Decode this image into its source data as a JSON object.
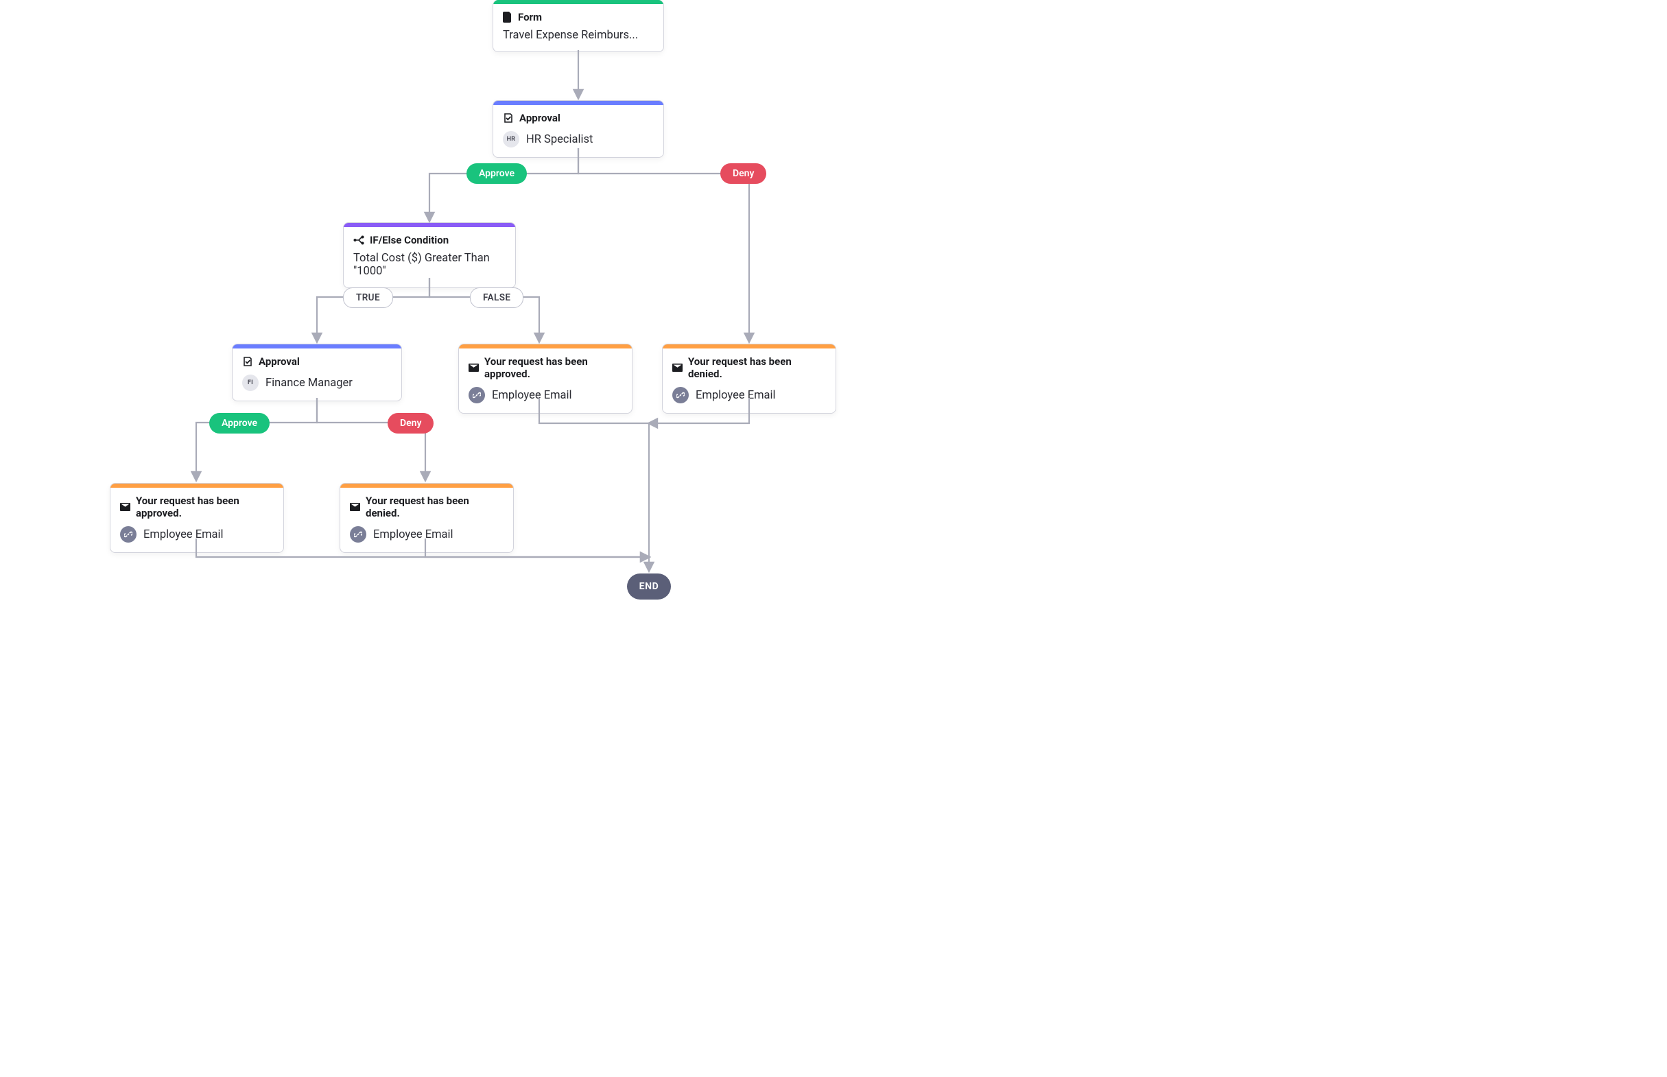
{
  "colors": {
    "green": "#19c37d",
    "blue": "#6a7dff",
    "purple": "#8a5cf6",
    "orange": "#ff9f43",
    "red": "#e64c5e",
    "arrow": "#a9abb8"
  },
  "labels": {
    "approve": "Approve",
    "deny": "Deny",
    "true": "TRUE",
    "false": "FALSE",
    "end": "END"
  },
  "nodes": {
    "form": {
      "type": "Form",
      "title": "Travel Expense Reimburs..."
    },
    "approval1": {
      "type": "Approval",
      "avatar": "HR",
      "assignee": "HR Specialist"
    },
    "condition": {
      "type": "IF/Else Condition",
      "expression": "Total Cost ($) Greater Than \"1000\""
    },
    "approval2": {
      "type": "Approval",
      "avatar": "FI",
      "assignee": "Finance Manager"
    },
    "emailApproved": {
      "type": "Your request has been approved.",
      "target": "Employee Email"
    },
    "emailDenied": {
      "type": "Your request has been denied.",
      "target": "Employee Email"
    }
  }
}
